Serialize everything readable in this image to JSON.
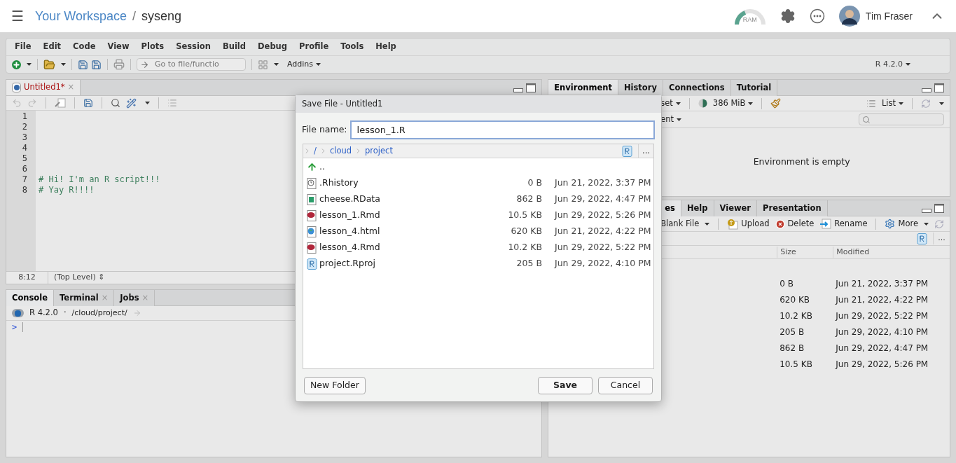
{
  "topbar": {
    "menu": "☰",
    "workspace": "Your Workspace",
    "separator": "/",
    "project": "syseng",
    "ram": "RAM",
    "user": "Tim Fraser"
  },
  "menubar": [
    "File",
    "Edit",
    "Code",
    "View",
    "Plots",
    "Session",
    "Build",
    "Debug",
    "Profile",
    "Tools",
    "Help"
  ],
  "toolbar": {
    "goto_placeholder": "Go to file/functio",
    "addins": "Addins",
    "r_version": "R 4.2.0"
  },
  "editor": {
    "tabs": [
      {
        "label": "Untitled1*",
        "close": "×",
        "selected": true
      }
    ],
    "lines": [
      {
        "number": "1"
      },
      {
        "number": "2"
      },
      {
        "number": "3"
      },
      {
        "number": "4"
      },
      {
        "number": "5"
      },
      {
        "number": "6"
      },
      {
        "number": "7",
        "code": "# Hi! I'm an R script!!!"
      },
      {
        "number": "8",
        "code": "# Yay R!!!!"
      }
    ],
    "position": "8:12",
    "scope": "(Top Level)",
    "scope_arrow": "⇕"
  },
  "console": {
    "tabs": [
      {
        "label": "Console",
        "selected": true
      },
      {
        "label": "Terminal",
        "close": "×",
        "selected": false
      },
      {
        "label": "Jobs",
        "close": "×",
        "selected": false
      }
    ],
    "version": "R 4.2.0",
    "dot": "·",
    "path": "/cloud/project/",
    "prompt": ">"
  },
  "environment": {
    "tabs": [
      {
        "label": "Environment",
        "selected": true
      },
      {
        "label": "History",
        "selected": false
      },
      {
        "label": "Connections",
        "selected": false
      },
      {
        "label": "Tutorial",
        "selected": false
      }
    ],
    "import": "set",
    "memory": "386 MiB",
    "view": "List",
    "scope": "ent",
    "empty": "Environment is empty"
  },
  "files": {
    "tabs": [
      {
        "label": "es",
        "selected": true
      },
      {
        "label": "Help",
        "selected": false
      },
      {
        "label": "Viewer",
        "selected": false
      },
      {
        "label": "Presentation",
        "selected": false
      }
    ],
    "actions": [
      {
        "kind": "blank",
        "label": "Blank File"
      },
      {
        "kind": "upload",
        "label": "Upload"
      },
      {
        "kind": "delete",
        "label": "Delete"
      },
      {
        "kind": "rename",
        "label": "Rename"
      },
      {
        "kind": "more",
        "label": "More"
      }
    ],
    "more": "...",
    "columns": [
      "Size",
      "Modified"
    ],
    "rows": [
      {
        "size": "0 B",
        "modified": "Jun 21, 2022, 3:37 PM"
      },
      {
        "size": "620 KB",
        "modified": "Jun 21, 2022, 4:22 PM"
      },
      {
        "size": "10.2 KB",
        "modified": "Jun 29, 2022, 5:22 PM"
      },
      {
        "size": "205 B",
        "modified": "Jun 29, 2022, 4:10 PM"
      },
      {
        "size": "862 B",
        "modified": "Jun 29, 2022, 4:47 PM"
      },
      {
        "size": "10.5 KB",
        "modified": "Jun 29, 2022, 5:26 PM"
      }
    ]
  },
  "dialog": {
    "title": "Save File - Untitled1",
    "label": "File name:",
    "value": "lesson_1.R",
    "path": [
      "/",
      "cloud",
      "project"
    ],
    "more": "...",
    "entries": [
      {
        "kind": "up",
        "name": ".."
      },
      {
        "kind": "history",
        "name": ".Rhistory",
        "size": "0 B",
        "modified": "Jun 21, 2022, 3:37 PM"
      },
      {
        "kind": "rdata",
        "name": "cheese.RData",
        "size": "862 B",
        "modified": "Jun 29, 2022, 4:47 PM"
      },
      {
        "kind": "rmd",
        "name": "lesson_1.Rmd",
        "size": "10.5 KB",
        "modified": "Jun 29, 2022, 5:26 PM"
      },
      {
        "kind": "html",
        "name": "lesson_4.html",
        "size": "620 KB",
        "modified": "Jun 21, 2022, 4:22 PM"
      },
      {
        "kind": "rmd",
        "name": "lesson_4.Rmd",
        "size": "10.2 KB",
        "modified": "Jun 29, 2022, 5:22 PM"
      },
      {
        "kind": "rproj",
        "name": "project.Rproj",
        "size": "205 B",
        "modified": "Jun 29, 2022, 4:10 PM"
      }
    ],
    "buttons": [
      {
        "kind": "secondary",
        "label": "New Folder"
      },
      {
        "kind": "primary",
        "label": "Save"
      },
      {
        "kind": "secondary",
        "label": "Cancel"
      }
    ]
  }
}
